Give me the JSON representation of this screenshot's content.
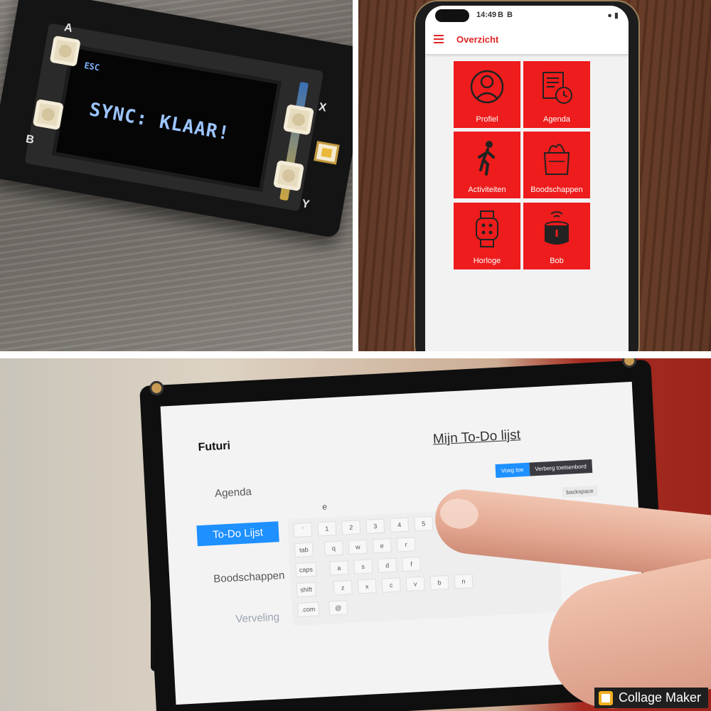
{
  "device": {
    "screen_esc": "ESC",
    "screen_message": "SYNC: KLAAR!",
    "button_labels": [
      "A",
      "B",
      "X",
      "Y"
    ]
  },
  "phone": {
    "status_time": "14:49",
    "status_icons": "B B",
    "app_title": "Overzicht",
    "tiles": [
      {
        "label": "Profiel",
        "icon": "person-icon"
      },
      {
        "label": "Agenda",
        "icon": "calendar-clock-icon"
      },
      {
        "label": "Activiteiten",
        "icon": "walking-icon"
      },
      {
        "label": "Boodschappen",
        "icon": "grocery-bag-icon"
      },
      {
        "label": "Horloge",
        "icon": "smartwatch-icon"
      },
      {
        "label": "Bob",
        "icon": "smart-speaker-icon"
      }
    ],
    "accent": "#ee1c1c"
  },
  "tablet": {
    "brand": "Futuri",
    "heading": "Mijn To-Do lijst",
    "nav": [
      "Agenda",
      "To-Do Lijst",
      "Boodschappen",
      "Verveling"
    ],
    "add_button": "Voeg toe",
    "hide_keyboard_button": "Verberg toetsenbord",
    "input_value": "e",
    "backspace_label": "backspace",
    "keys": {
      "row1": [
        "`",
        "1",
        "2",
        "3",
        "4",
        "5"
      ],
      "row2": [
        "tab",
        "q",
        "w",
        "e",
        "r"
      ],
      "row3": [
        "caps",
        "a",
        "s",
        "d",
        "f"
      ],
      "row4": [
        "shift",
        "z",
        "x",
        "c",
        "v",
        "b",
        "n"
      ],
      "row5": [
        ".com",
        "@"
      ]
    },
    "accent": "#1e90ff"
  },
  "watermark": "Collage Maker"
}
